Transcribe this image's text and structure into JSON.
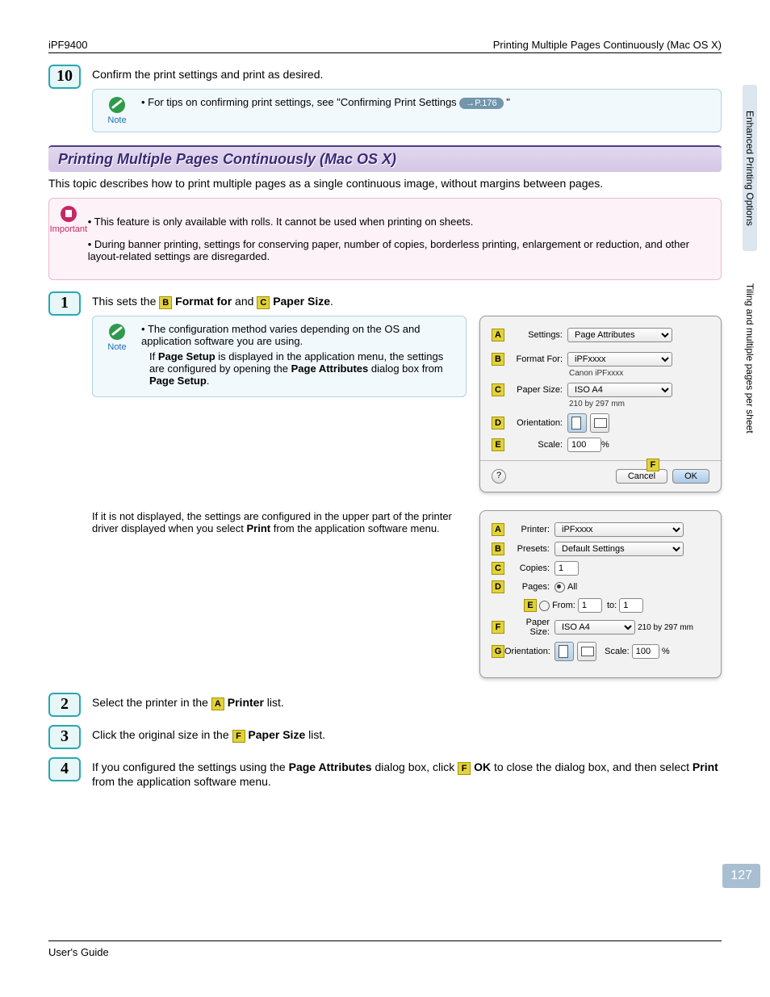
{
  "header": {
    "left": "iPF9400",
    "right": "Printing Multiple Pages Continuously (Mac OS X)"
  },
  "footer": {
    "left": "User's Guide"
  },
  "sideTabs": {
    "a": "Enhanced Printing Options",
    "b": "Tiling and multiple pages per sheet"
  },
  "pageNum": "127",
  "step10": {
    "num": "10",
    "text": "Confirm the print settings and print as desired.",
    "note": {
      "label": "Note",
      "line1a": "For tips on confirming print settings, see \"Confirming Print Settings ",
      "pill": "→P.176",
      "line1b": " \""
    }
  },
  "sectionTitle": "Printing Multiple Pages Continuously (Mac OS X)",
  "intro": "This topic describes how to print multiple pages as a single continuous image, without margins between pages.",
  "important": {
    "label": "Important",
    "b1": "This feature is only available with rolls. It cannot be used when printing on sheets.",
    "b2": "During banner printing, settings for conserving paper, number of copies, borderless printing, enlargement or reduction, and other layout-related settings are disregarded."
  },
  "step1": {
    "num": "1",
    "text_a": "This sets the ",
    "letterB": "B",
    "bold1": "Format for",
    "and": " and ",
    "letterC": "C",
    "bold2": "Paper Size",
    "period": ".",
    "noteLabel": "Note",
    "n1": "The configuration method varies depending on the OS and application software you are using.",
    "n2a": "If ",
    "n2b": "Page Setup",
    "n2c": " is displayed in the application menu, the settings are configured by opening the ",
    "n2d": "Page Attributes",
    "n2e": " dialog box from ",
    "n2f": "Page Setup",
    "n2g": ".",
    "p2a": "If it is not displayed, the settings are configured in the upper part of the printer driver displayed when you select ",
    "p2b": "Print",
    "p2c": " from the application software menu."
  },
  "dlg1": {
    "A": "A",
    "settingsLbl": "Settings:",
    "settingsVal": "Page Attributes",
    "B": "B",
    "formatLbl": "Format For:",
    "formatVal": "iPFxxxx",
    "formatSub": "Canon iPFxxxx",
    "C": "C",
    "paperLbl": "Paper Size:",
    "paperVal": "ISO A4",
    "paperSub": "210 by 297 mm",
    "D": "D",
    "orientLbl": "Orientation:",
    "E": "E",
    "scaleLbl": "Scale:",
    "scaleVal": "100",
    "scalePct": "%",
    "F": "F",
    "cancel": "Cancel",
    "ok": "OK",
    "help": "?"
  },
  "dlg2": {
    "A": "A",
    "printerLbl": "Printer:",
    "printerVal": "iPFxxxx",
    "B": "B",
    "presetsLbl": "Presets:",
    "presetsVal": "Default Settings",
    "C": "C",
    "copiesLbl": "Copies:",
    "copiesVal": "1",
    "D": "D",
    "pagesLbl": "Pages:",
    "allLbl": "All",
    "E": "E",
    "fromLbl": "From:",
    "fromVal": "1",
    "toLbl": "to:",
    "toVal": "1",
    "F": "F",
    "paperLbl": "Paper Size:",
    "paperVal": "ISO A4",
    "paperSub": "210 by 297 mm",
    "G": "G",
    "orientLbl": "Orientation:",
    "scaleLbl": "Scale:",
    "scaleVal": "100",
    "scalePct": "%"
  },
  "step2": {
    "num": "2",
    "a": "Select the printer in the ",
    "L": "A",
    "b": "Printer",
    "c": " list."
  },
  "step3": {
    "num": "3",
    "a": "Click the original size in the ",
    "L": "F",
    "b": "Paper Size",
    "c": " list."
  },
  "step4": {
    "num": "4",
    "a": "If you configured the settings using the ",
    "b": "Page Attributes",
    "c": " dialog box, click ",
    "L": "F",
    "d": "OK",
    "e": " to close the dialog box, and then select ",
    "f": "Print",
    "g": " from the application software menu."
  }
}
